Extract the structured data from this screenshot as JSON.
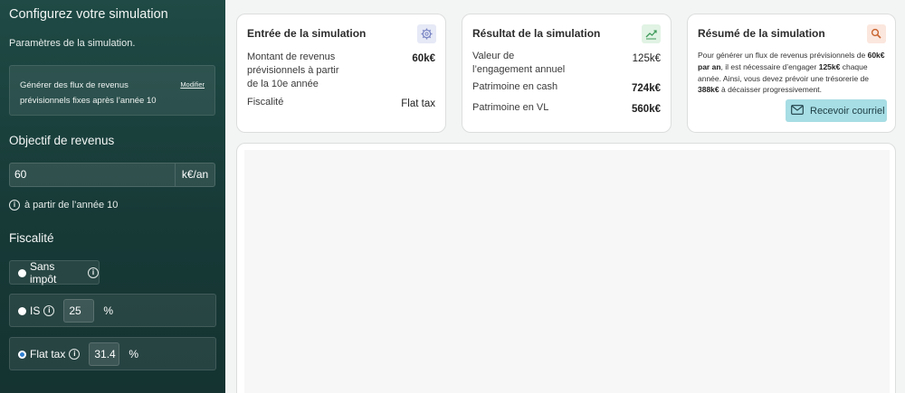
{
  "sidebar": {
    "title": "Configurez votre simulation",
    "subtitle": "Paramètres de la simulation.",
    "generate": {
      "text": "Générer des flux de revenus prévisionnels fixes après l’année 10",
      "modify_label": "Modifier"
    },
    "objective": {
      "title": "Objectif de revenus",
      "value": "60",
      "unit": "k€/an",
      "info": "à partir de l’année 10"
    },
    "fiscality": {
      "title": "Fiscalité",
      "options": [
        {
          "label": "Sans impôt",
          "selected": false
        },
        {
          "label": "IS",
          "rate": "25",
          "unit": "%",
          "selected": false
        },
        {
          "label": "Flat tax",
          "rate": "31.4",
          "unit": "%",
          "selected": true
        }
      ]
    }
  },
  "cards": {
    "input": {
      "title": "Entrée de la simulation",
      "icon": "gear-icon",
      "rows": [
        {
          "label": "Montant de revenus prévisionnels à partir de la 10e année",
          "value": "60k€"
        },
        {
          "label": "Fiscalité",
          "value": "Flat tax"
        }
      ]
    },
    "result": {
      "title": "Résultat de la simulation",
      "icon": "chart-line-icon",
      "rows": [
        {
          "label": "Valeur de l’engagement annuel",
          "value": "125k€"
        },
        {
          "label": "Patrimoine en cash",
          "value": "724k€"
        },
        {
          "label": "Patrimoine en VL",
          "value": "560k€"
        }
      ]
    },
    "summary": {
      "title": "Résumé de la simulation",
      "icon": "search-icon",
      "p1": "Pour générer un flux de revenus prévisionnels de ",
      "b1": "60k€ par an",
      "p2": ", il est nécessaire d’engager ",
      "b2": "125k€",
      "p3": " chaque année. Ainsi, vous devez prévoir une trésorerie de ",
      "b3": "388k€",
      "p4": " à décaisser progressivement.",
      "button_label": "Recevoir courriel"
    }
  },
  "colors": {
    "sidebar": "#1f4a45",
    "accent_button": "#a7dde4",
    "radio_selected": "#2f7fd0"
  }
}
